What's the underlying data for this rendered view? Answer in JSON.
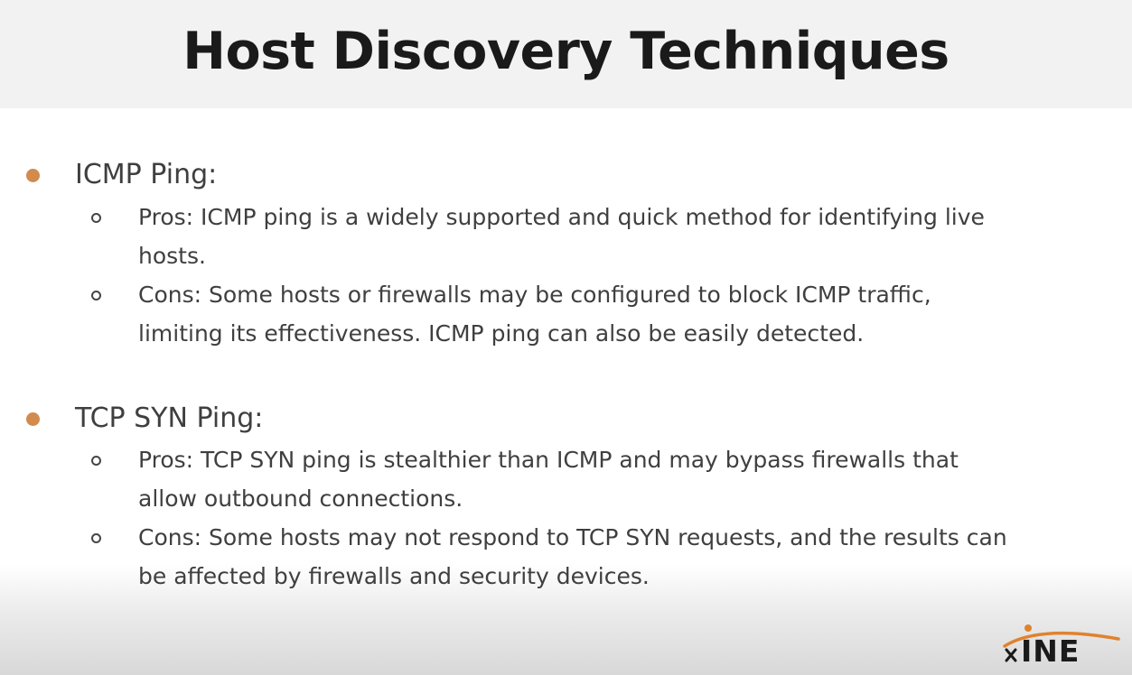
{
  "slide": {
    "title": "Host Discovery Techniques"
  },
  "sections": [
    {
      "heading": "ICMP Ping:",
      "points": [
        {
          "lines": [
            "Pros: ICMP ping is a widely supported and quick method for identifying live",
            "hosts."
          ]
        },
        {
          "lines": [
            "Cons: Some hosts or firewalls may be configured to block ICMP traffic,",
            "limiting its effectiveness. ICMP ping can also be easily detected."
          ]
        }
      ]
    },
    {
      "heading": "TCP SYN Ping:",
      "points": [
        {
          "lines": [
            "Pros: TCP SYN ping is stealthier than ICMP and may bypass firewalls that",
            "allow outbound connections."
          ]
        },
        {
          "lines": [
            "Cons: Some hosts may not respond to TCP SYN requests, and the results can",
            "be affected by firewalls and security devices."
          ]
        }
      ]
    }
  ],
  "logo": {
    "text": "INE",
    "icon": "ine-logo-icon",
    "colors": {
      "arc": "#e0822f",
      "text": "#1a1a1a"
    }
  },
  "colors": {
    "bullet": "#d18b4e",
    "title_bar": "#f2f2f2",
    "text": "#3f3f3f"
  }
}
